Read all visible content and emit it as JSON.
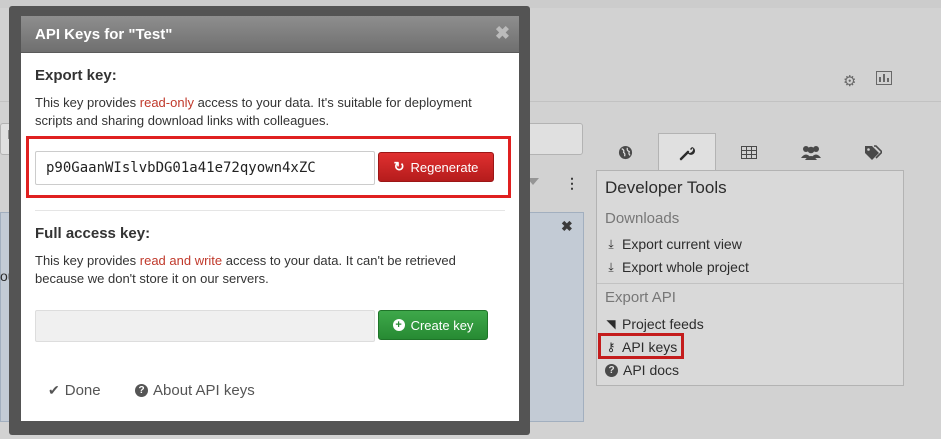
{
  "modal": {
    "title": "API Keys for \"Test\"",
    "close_glyph": "✖",
    "export_section": {
      "title": "Export key:",
      "desc_before": "This key provides ",
      "desc_highlight": "read-only",
      "desc_after": " access to your data. It's suitable for deployment scripts and sharing download links with colleagues.",
      "key_value": "p90GaanWIslvbDG01a41e72qyown4xZC",
      "regenerate_label": "Regenerate"
    },
    "full_section": {
      "title": "Full access key:",
      "desc_before": "This key provides ",
      "desc_highlight": "read and write",
      "desc_after": " access to your data. It can't be retrieved because we don't store it on our servers.",
      "key_value": "",
      "create_label": "Create key"
    },
    "footer": {
      "done_label": "Done",
      "about_label": "About API keys"
    }
  },
  "background": {
    "left_text_fragment": "out",
    "dev_tools": {
      "title": "Developer Tools",
      "downloads_label": "Downloads",
      "export_current_view": "Export current view",
      "export_whole_project": "Export whole project",
      "export_api_label": "Export API",
      "project_feeds": "Project feeds",
      "api_keys": "API keys",
      "api_docs": "API docs"
    }
  },
  "colors": {
    "accent_red": "#c0392b",
    "regenerate_button": "#c72323",
    "create_button": "#2f9a3c",
    "highlight_box": "#e02020",
    "modal_header": "#7d7d7d"
  },
  "icons": {
    "regenerate": "refresh-icon",
    "create": "plus-circle-icon",
    "done": "check-icon",
    "about": "question-circle-icon",
    "tab_globe": "globe-icon",
    "tab_wrench": "wrench-icon",
    "tab_table": "table-icon",
    "tab_users": "users-icon",
    "tab_tags": "tags-icon"
  }
}
